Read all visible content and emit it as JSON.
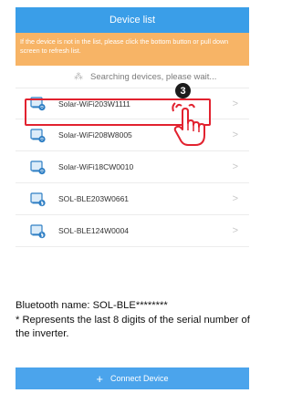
{
  "header": {
    "title": "Device list"
  },
  "banner": {
    "text": "If the device is not in the list, please click the bottom button or pull down screen to refresh list."
  },
  "search": {
    "status": "Searching devices, please wait..."
  },
  "devices": [
    {
      "name": "Solar-WiFi203W1111",
      "icon": "wifi-device-icon"
    },
    {
      "name": "Solar-WiFi208W8005",
      "icon": "wifi-device-icon"
    },
    {
      "name": "Solar-WiFi18CW0010",
      "icon": "wifi-device-icon"
    },
    {
      "name": "SOL-BLE203W0661",
      "icon": "bluetooth-device-icon"
    },
    {
      "name": "SOL-BLE124W0004",
      "icon": "bluetooth-device-icon"
    }
  ],
  "annotation": {
    "step": "3"
  },
  "note": {
    "line1": "Bluetooth name: SOL-BLE********",
    "line2": "* Represents the last 8 digits of the serial number of the inverter."
  },
  "footer": {
    "connect_label": "Connect Device"
  },
  "colors": {
    "primary": "#3a9ee8",
    "warning": "#f7b466",
    "highlight": "#e2222f"
  }
}
